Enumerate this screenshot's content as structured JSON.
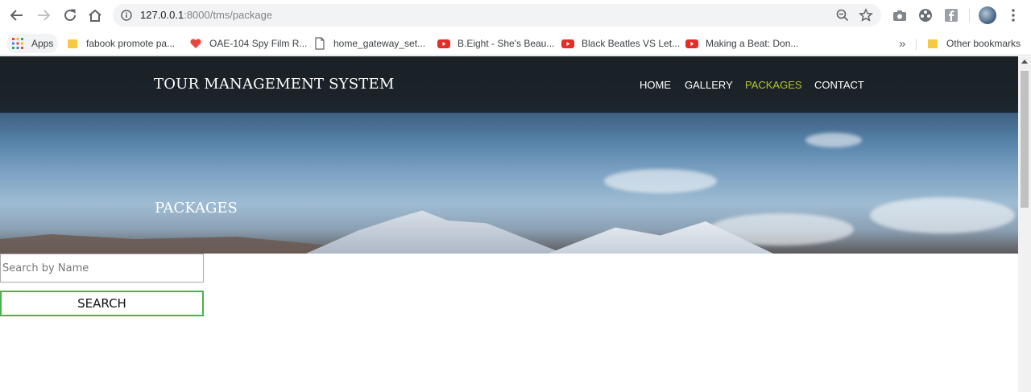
{
  "browser": {
    "url_host": "127.0.0.1",
    "url_path": ":8000/tms/package",
    "bookmarks": [
      {
        "label": "Apps",
        "icon": "apps-grid-icon"
      },
      {
        "label": "fabook promote pa...",
        "icon": "folder-icon"
      },
      {
        "label": "OAE-104 Spy Film R...",
        "icon": "heart-icon"
      },
      {
        "label": "home_gateway_set...",
        "icon": "page-icon"
      },
      {
        "label": "B.Eight - She's Beau...",
        "icon": "youtube-icon"
      },
      {
        "label": "Black Beatles VS Let...",
        "icon": "youtube-icon"
      },
      {
        "label": "Making a Beat: Don...",
        "icon": "youtube-icon"
      },
      {
        "label": "Other bookmarks",
        "icon": "folder-icon"
      }
    ],
    "overflow": "»",
    "colors": {
      "folder": "#f6c942",
      "youtube": "#e52d27",
      "heart": "#e8453c"
    }
  },
  "site": {
    "brand": "TOUR MANAGEMENT SYSTEM",
    "menu": {
      "home": "HOME",
      "gallery": "GALLERY",
      "packages": "PACKAGES",
      "contact": "CONTACT"
    },
    "active_color": "#b5c42a",
    "hero_title": "PACKAGES",
    "search": {
      "placeholder": "Search by Name",
      "button": "SEARCH"
    }
  }
}
